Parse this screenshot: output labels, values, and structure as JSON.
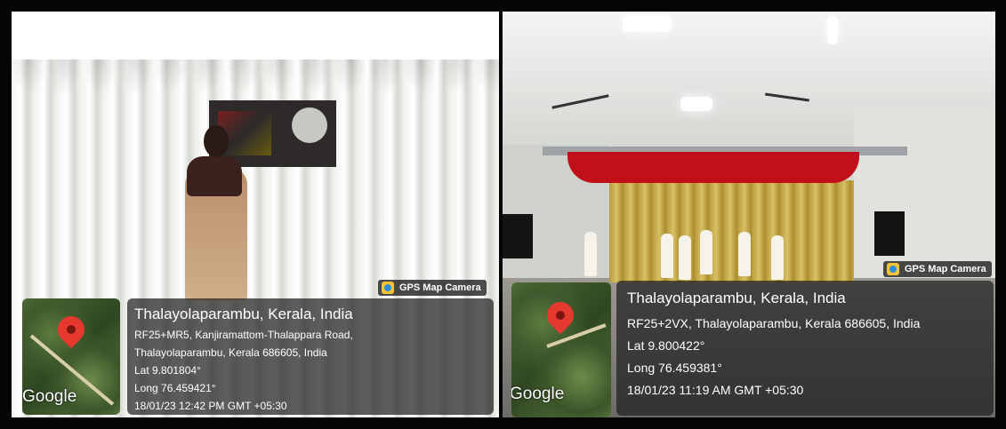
{
  "photos": [
    {
      "gps_label": "GPS Map Camera",
      "location_title": "Thalayolaparambu, Kerala, India",
      "address_lines": [
        "RF25+MR5, Kanjiramattom-Thalappara Road,",
        "Thalayolaparambu, Kerala 686605, India"
      ],
      "lat": "Lat 9.801804°",
      "long": "Long 76.459421°",
      "datetime": "18/01/23 12:42 PM GMT +05:30",
      "map_brand": "Google"
    },
    {
      "gps_label": "GPS Map Camera",
      "location_title": "Thalayolaparambu, Kerala, India",
      "address_lines": [
        "RF25+2VX, Thalayolaparambu, Kerala 686605, India"
      ],
      "lat": "Lat 9.800422°",
      "long": "Long 76.459381°",
      "datetime": "18/01/23 11:19 AM GMT +05:30",
      "map_brand": "Google"
    }
  ],
  "colors": {
    "pin": "#e5392f",
    "stage_curtain": "#c2101a",
    "overlay": "#1e1e1e"
  }
}
